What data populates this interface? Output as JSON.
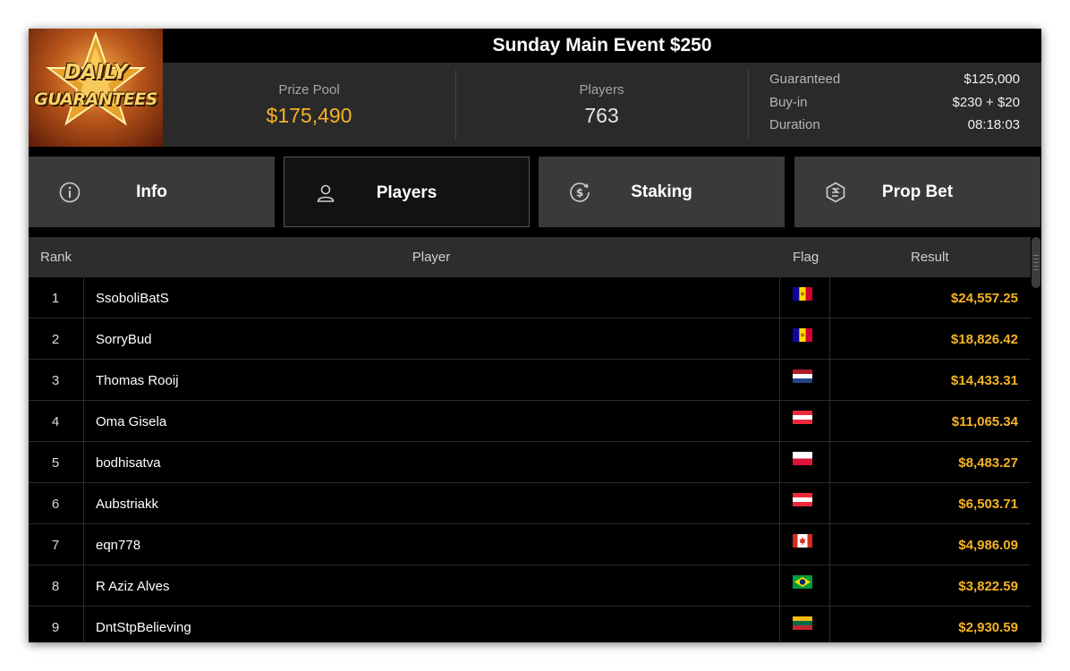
{
  "logo": {
    "line1": "DAILY",
    "line2": "GUARANTEES"
  },
  "title": "Sunday Main Event $250",
  "stats": {
    "prize_pool_label": "Prize Pool",
    "prize_pool_value": "$175,490",
    "players_label": "Players",
    "players_value": "763"
  },
  "details": [
    {
      "key": "Guaranteed",
      "value": "$125,000"
    },
    {
      "key": "Buy-in",
      "value": "$230 + $20"
    },
    {
      "key": "Duration",
      "value": "08:18:03"
    }
  ],
  "tabs": [
    {
      "label": "Info",
      "icon": "info-icon"
    },
    {
      "label": "Players",
      "icon": "user-icon",
      "active": true
    },
    {
      "label": "Staking",
      "icon": "dollar-circle-icon"
    },
    {
      "label": "Prop Bet",
      "icon": "prop-bet-icon"
    }
  ],
  "table": {
    "columns": {
      "rank": "Rank",
      "player": "Player",
      "flag": "Flag",
      "result": "Result"
    },
    "rows": [
      {
        "rank": "1",
        "player": "SsoboliBatS",
        "flag": "andorra",
        "result": "$24,557.25"
      },
      {
        "rank": "2",
        "player": "SorryBud",
        "flag": "andorra",
        "result": "$18,826.42"
      },
      {
        "rank": "3",
        "player": "Thomas Rooij",
        "flag": "netherlands",
        "result": "$14,433.31"
      },
      {
        "rank": "4",
        "player": "Oma Gisela",
        "flag": "austria",
        "result": "$11,065.34"
      },
      {
        "rank": "5",
        "player": "bodhisatva",
        "flag": "poland",
        "result": "$8,483.27"
      },
      {
        "rank": "6",
        "player": "Aubstriakk",
        "flag": "austria",
        "result": "$6,503.71"
      },
      {
        "rank": "7",
        "player": "eqn778",
        "flag": "canada",
        "result": "$4,986.09"
      },
      {
        "rank": "8",
        "player": "R Aziz Alves",
        "flag": "brazil",
        "result": "$3,822.59"
      },
      {
        "rank": "9",
        "player": "DntStpBelieving",
        "flag": "lithuania",
        "result": "$2,930.59"
      }
    ]
  },
  "colors": {
    "accent_gold": "#f5b324",
    "background": "#000000",
    "panel": "#2a2a2a",
    "tab": "#3a3a3a"
  }
}
